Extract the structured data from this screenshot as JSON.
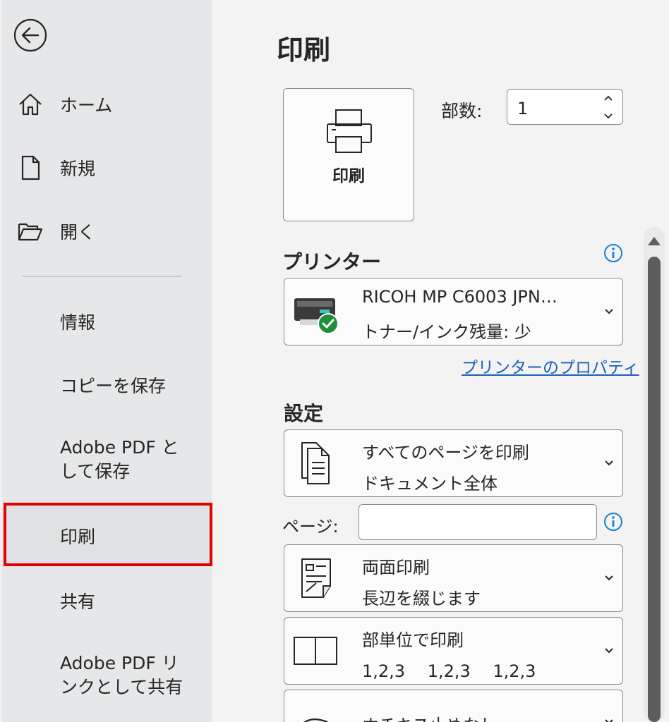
{
  "sidebar": {
    "back_icon": "back-arrow-icon",
    "items": [
      {
        "label": "ホーム",
        "icon": "home-icon"
      },
      {
        "label": "新規",
        "icon": "new-document-icon"
      },
      {
        "label": "開く",
        "icon": "open-folder-icon"
      },
      {
        "label": "情報"
      },
      {
        "label": "コピーを保存"
      },
      {
        "label_line1": "Adobe PDF と",
        "label_line2": "して保存"
      },
      {
        "label": "印刷",
        "selected": true
      },
      {
        "label": "共有"
      },
      {
        "label_line1": "Adobe PDF リ",
        "label_line2": "ンクとして共有"
      }
    ]
  },
  "main": {
    "title": "印刷",
    "print_button": {
      "label": "印刷",
      "icon": "printer-icon"
    },
    "copies": {
      "label": "部数:",
      "value": "1"
    },
    "printer_section": {
      "title": "プリンター",
      "printer_name": "RICOH MP C6003 JPN…",
      "status": "トナー/インク残量: 少",
      "properties_link": "プリンターのプロパティ"
    },
    "settings_section": {
      "title": "設定",
      "print_range": {
        "line1": "すべてのページを印刷",
        "line2": "ドキュメント全体"
      },
      "pages_label": "ページ:",
      "pages_value": "",
      "duplex": {
        "line1": "両面印刷",
        "line2": "長辺を綴じます"
      },
      "collation": {
        "line1": "部単位で印刷",
        "line2": "1,2,3　 1,2,3　 1,2,3"
      },
      "staple": {
        "line1": "ホチキス止めなし"
      }
    }
  },
  "colors": {
    "selection_border": "#e60000",
    "link": "#1c5fb8",
    "info": "#1c7fd6",
    "check": "#1f8f3a"
  }
}
